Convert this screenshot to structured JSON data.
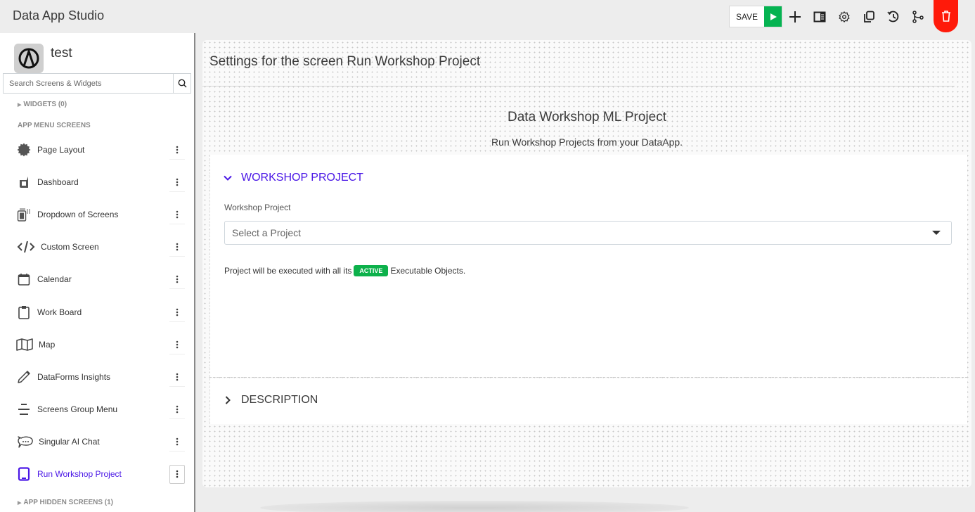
{
  "app": {
    "title": "Data App Studio"
  },
  "toolbar": {
    "save_label": "SAVE",
    "icons": [
      "play-icon",
      "plus-icon",
      "panel-icon",
      "gear-icon",
      "copy-icon",
      "history-icon",
      "branch-icon",
      "trash-icon"
    ],
    "run_color": "#05b351",
    "delete_color": "#ff1a0a"
  },
  "sidebar": {
    "project_name": "test",
    "search": {
      "placeholder": "Search Screens & Widgets",
      "value": ""
    },
    "widgets_label": "WIDGETS (0)",
    "app_menu_label": "APP MENU SCREENS",
    "hidden_label": "APP HIDDEN SCREENS (1)",
    "items": [
      {
        "label": "Page Layout",
        "icon": "gear-badge-icon",
        "active": false
      },
      {
        "label": "Dashboard",
        "icon": "dashboard-icon",
        "active": false
      },
      {
        "label": "Dropdown of Screens",
        "icon": "dropdown-screens-icon",
        "active": false
      },
      {
        "label": "Custom Screen",
        "icon": "code-icon",
        "active": false
      },
      {
        "label": "Calendar",
        "icon": "calendar-icon",
        "active": false
      },
      {
        "label": "Work Board",
        "icon": "clipboard-icon",
        "active": false
      },
      {
        "label": "Map",
        "icon": "map-icon",
        "active": false
      },
      {
        "label": "DataForms Insights",
        "icon": "pencil-icon",
        "active": false
      },
      {
        "label": "Screens Group Menu",
        "icon": "menu-lines-icon",
        "active": false
      },
      {
        "label": "Singular AI Chat",
        "icon": "chat-icon",
        "active": false
      },
      {
        "label": "Run Workshop Project",
        "icon": "tablet-icon",
        "active": true
      }
    ],
    "accent_color": "#4a17e6"
  },
  "main": {
    "settings_title": "Settings for the screen Run Workshop Project",
    "widget_title": "Data Workshop ML Project",
    "widget_subtitle": "Run Workshop Projects from your DataApp.",
    "sections": [
      {
        "title": "WORKSHOP PROJECT",
        "expanded": true,
        "field_label": "Workshop Project",
        "select_placeholder": "Select a Project",
        "note_before": "Project will be executed with all its",
        "badge": "ACTIVE",
        "note_after": "Executable Objects.",
        "badge_color": "#0db14b"
      },
      {
        "title": "DESCRIPTION",
        "expanded": false
      }
    ]
  }
}
